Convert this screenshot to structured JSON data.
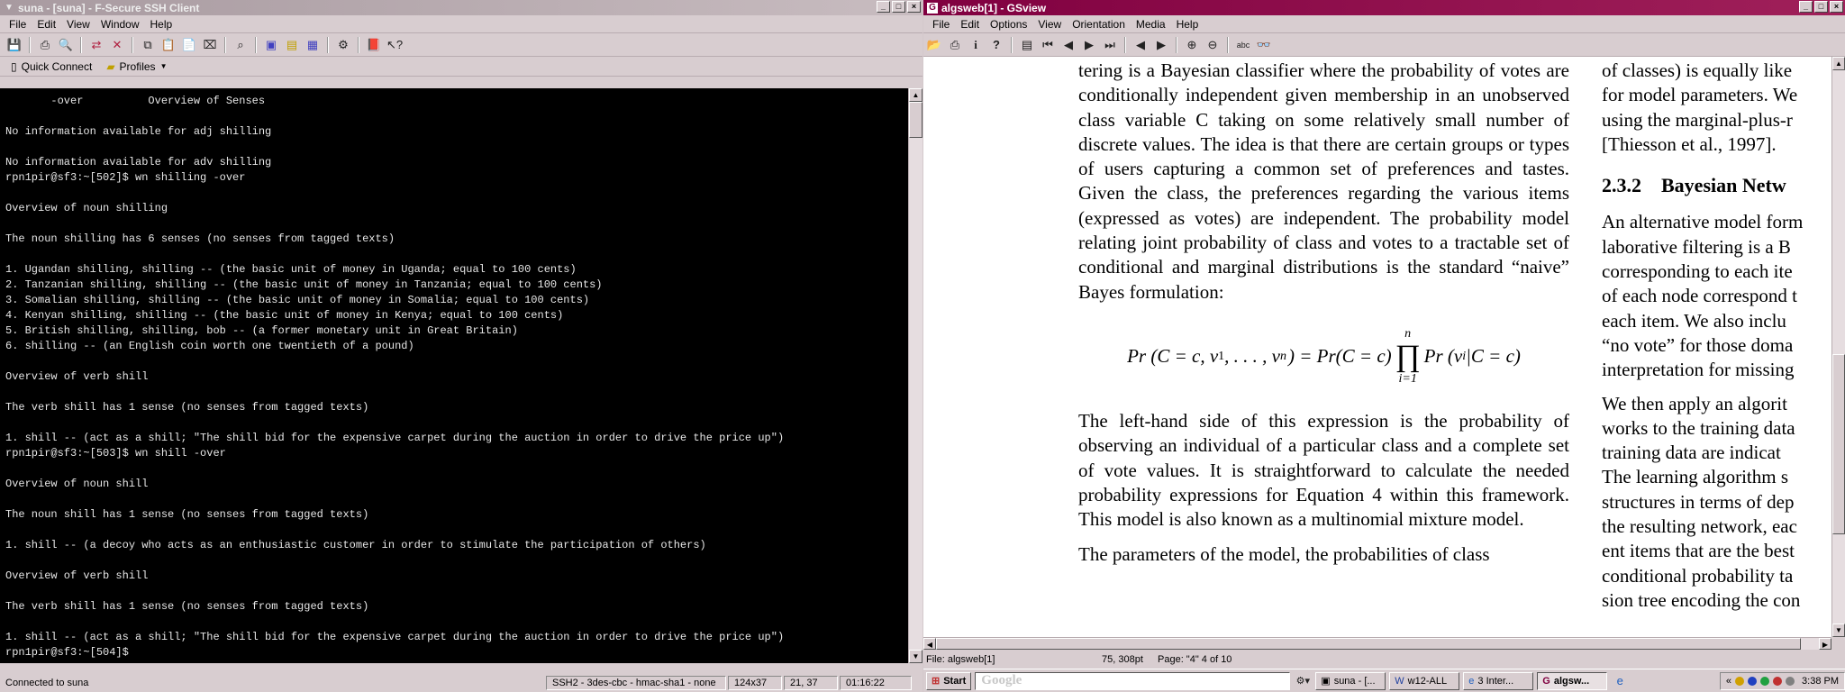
{
  "ssh": {
    "title": "suna - [suna] - F-Secure SSH Client",
    "menu": [
      "File",
      "Edit",
      "View",
      "Window",
      "Help"
    ],
    "quick_connect": "Quick Connect",
    "profiles": "Profiles",
    "terminal_lines": [
      "       -over          Overview of Senses",
      "",
      "No information available for adj shilling",
      "",
      "No information available for adv shilling",
      "rpn1pir@sf3:~[502]$ wn shilling -over",
      "",
      "Overview of noun shilling",
      "",
      "The noun shilling has 6 senses (no senses from tagged texts)",
      "",
      "1. Ugandan shilling, shilling -- (the basic unit of money in Uganda; equal to 100 cents)",
      "2. Tanzanian shilling, shilling -- (the basic unit of money in Tanzania; equal to 100 cents)",
      "3. Somalian shilling, shilling -- (the basic unit of money in Somalia; equal to 100 cents)",
      "4. Kenyan shilling, shilling -- (the basic unit of money in Kenya; equal to 100 cents)",
      "5. British shilling, shilling, bob -- (a former monetary unit in Great Britain)",
      "6. shilling -- (an English coin worth one twentieth of a pound)",
      "",
      "Overview of verb shill",
      "",
      "The verb shill has 1 sense (no senses from tagged texts)",
      "",
      "1. shill -- (act as a shill; \"The shill bid for the expensive carpet during the auction in order to drive the price up\")",
      "rpn1pir@sf3:~[503]$ wn shill -over",
      "",
      "Overview of noun shill",
      "",
      "The noun shill has 1 sense (no senses from tagged texts)",
      "",
      "1. shill -- (a decoy who acts as an enthusiastic customer in order to stimulate the participation of others)",
      "",
      "Overview of verb shill",
      "",
      "The verb shill has 1 sense (no senses from tagged texts)",
      "",
      "1. shill -- (act as a shill; \"The shill bid for the expensive carpet during the auction in order to drive the price up\")",
      "rpn1pir@sf3:~[504]$ "
    ],
    "status": {
      "connected": "Connected to suna",
      "cipher": "SSH2 - 3des-cbc - hmac-sha1 - none",
      "size": "124x37",
      "cursor": "21, 37",
      "time": "01:16:22"
    }
  },
  "gsview": {
    "title": "algsweb[1] - GSview",
    "menu": [
      "File",
      "Edit",
      "Options",
      "View",
      "Orientation",
      "Media",
      "Help"
    ],
    "para1": "tering is a Bayesian classifier where the probability of votes are conditionally independent given membership in an unobserved class variable C taking on some relatively small number of discrete values.  The idea is that there are certain groups or types of users capturing a common set of preferences and tastes. Given the class, the preferences regarding the various items (expressed as votes) are independent. The probability model relating joint probability of class and votes to a tractable set of conditional and marginal distributions is the standard “naive” Bayes formulation:",
    "eq_left": "Pr (C = c, v",
    "eq_mid": "1",
    "eq_rest": ", . . . , v",
    "eq_n": "n",
    "eq_right": ") = Pr(C = c)",
    "prod_top": "n",
    "prod_bottom": "i=1",
    "eq_tail": "Pr (v",
    "eq_tail_sub": "i",
    "eq_tail_end": "|C = c)",
    "para2": "The left-hand side of this expression is the probability of observing an individual of a particular class and a complete set of vote values. It is straightforward to calculate the needed probability expressions for Equation 4 within this framework. This model is also known as a multinomial mixture model.",
    "para3": "The parameters of the model, the probabilities of class",
    "col2_lines": [
      "of classes) is equally like",
      "for model parameters. We",
      "using the marginal-plus-r",
      "[Thiesson et al., 1997]."
    ],
    "col2_heading": "2.3.2    Bayesian Netw",
    "col2_lines_b": [
      "An alternative model form",
      "laborative filtering is a B",
      "corresponding to each ite",
      "of each node correspond t",
      "each item.  We also inclu",
      "“no vote” for those doma",
      "interpretation for missing"
    ],
    "col2_lines_c": [
      "We then apply an algorit",
      "works to the training data",
      "training data are indicat",
      "The learning algorithm s",
      "structures in terms of dep",
      "the resulting network, eac",
      "ent items that are the best",
      "conditional probability ta",
      "sion tree encoding the con"
    ],
    "status": {
      "file": "File: algsweb[1]",
      "coords": "75, 308pt",
      "page": "Page: \"4\"  4 of 10"
    }
  },
  "taskbar": {
    "start": "Start",
    "google": "Google",
    "tasks": [
      "suna - [...",
      "w12-ALL",
      "3 Inter...",
      "algsw..."
    ],
    "clock": "3:38 PM"
  }
}
